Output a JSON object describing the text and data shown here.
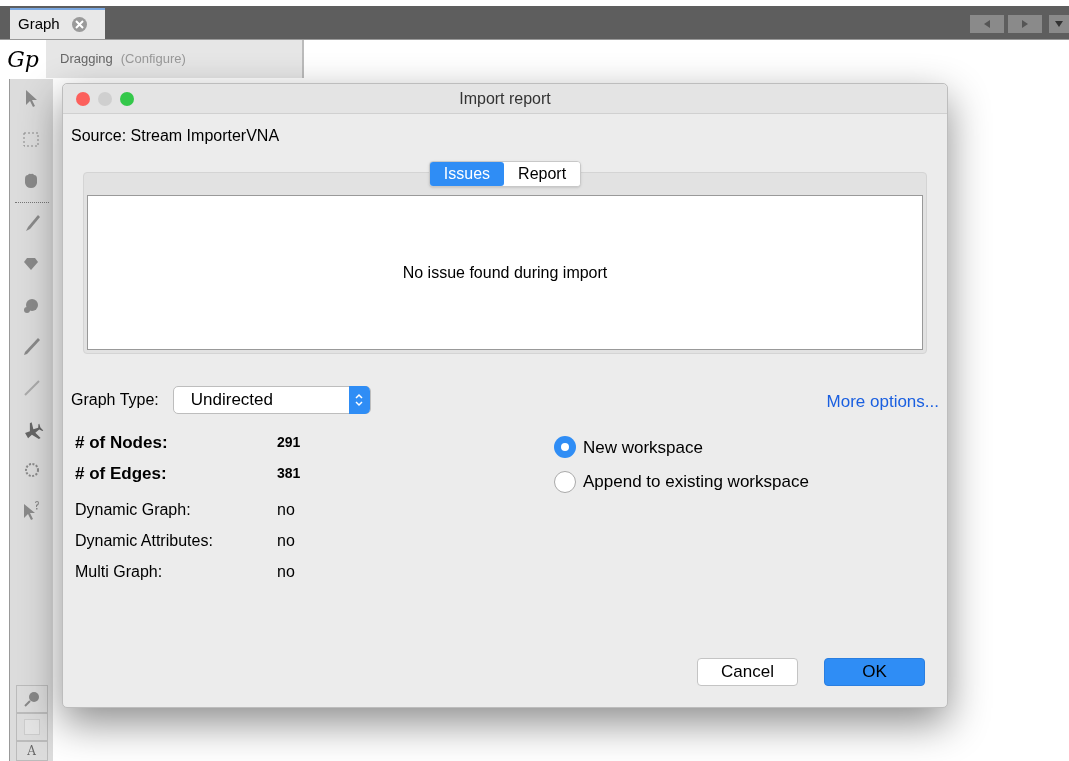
{
  "tab": {
    "label": "Graph",
    "selected": true
  },
  "toolbar": {
    "logo": "Gp",
    "mode": "Dragging",
    "configure": "(Configure)"
  },
  "bottom_tools": {
    "text_tool": "A"
  },
  "dialog": {
    "title": "Import report",
    "source": "Source: Stream ImporterVNA",
    "tabs": [
      {
        "label": "Issues",
        "selected": true
      },
      {
        "label": "Report",
        "selected": false
      }
    ],
    "message": "No issue found during import",
    "graph_type": {
      "label": "Graph Type:",
      "value": "Undirected"
    },
    "more_options": "More options...",
    "stats": [
      {
        "label": "# of Nodes:",
        "value": "291",
        "kind": "bold"
      },
      {
        "label": "# of Edges:",
        "value": "381",
        "kind": "bold"
      },
      {
        "label": "Dynamic Graph:",
        "value": "no",
        "kind": "plain"
      },
      {
        "label": "Dynamic Attributes:",
        "value": "no",
        "kind": "plain"
      },
      {
        "label": "Multi Graph:",
        "value": "no",
        "kind": "plain"
      }
    ],
    "workspace_options": [
      {
        "label": "New workspace",
        "selected": true
      },
      {
        "label": "Append to existing workspace",
        "selected": false
      }
    ],
    "buttons": [
      {
        "label": "Cancel",
        "kind": "secondary"
      },
      {
        "label": "OK",
        "kind": "primary"
      }
    ]
  }
}
